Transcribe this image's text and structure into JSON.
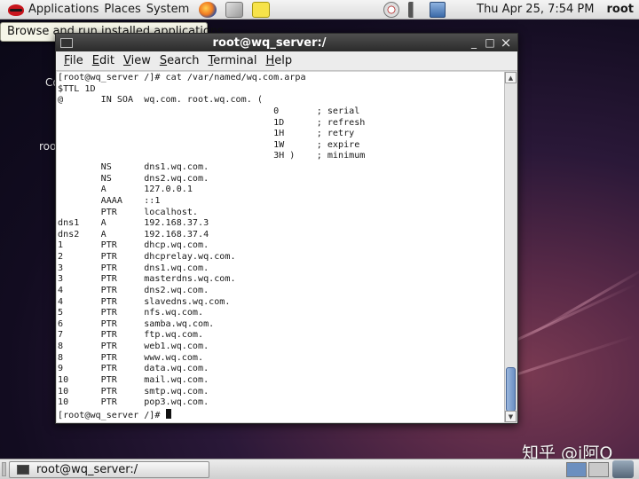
{
  "top_panel": {
    "menus": [
      "Applications",
      "Places",
      "System"
    ],
    "clock": "Thu Apr 25,  7:54 PM",
    "user": "root"
  },
  "tooltip": "Browse and run installed applications",
  "desktop": {
    "fragments": [
      "Co",
      "roo"
    ]
  },
  "window": {
    "title": "root@wq_server:/",
    "controls": {
      "minimize": "_",
      "maximize": "□",
      "close": "×"
    },
    "menus": [
      {
        "first": "F",
        "rest": "ile"
      },
      {
        "first": "E",
        "rest": "dit"
      },
      {
        "first": "V",
        "rest": "iew"
      },
      {
        "first": "S",
        "rest": "earch"
      },
      {
        "first": "T",
        "rest": "erminal"
      },
      {
        "first": "H",
        "rest": "elp"
      }
    ]
  },
  "terminal": {
    "lines": [
      "[root@wq_server /]# cat /var/named/wq.com.arpa",
      "$TTL 1D",
      "@       IN SOA  wq.com. root.wq.com. (",
      "                                        0       ; serial",
      "                                        1D      ; refresh",
      "                                        1H      ; retry",
      "                                        1W      ; expire",
      "                                        3H )    ; minimum",
      "        NS      dns1.wq.com.",
      "        NS      dns2.wq.com.",
      "        A       127.0.0.1",
      "        AAAA    ::1",
      "        PTR     localhost.",
      "dns1    A       192.168.37.3",
      "dns2    A       192.168.37.4",
      "1       PTR     dhcp.wq.com.",
      "2       PTR     dhcprelay.wq.com.",
      "3       PTR     dns1.wq.com.",
      "3       PTR     masterdns.wq.com.",
      "4       PTR     dns2.wq.com.",
      "4       PTR     slavedns.wq.com.",
      "5       PTR     nfs.wq.com.",
      "6       PTR     samba.wq.com.",
      "7       PTR     ftp.wq.com.",
      "8       PTR     web1.wq.com.",
      "8       PTR     www.wq.com.",
      "9       PTR     data.wq.com.",
      "10      PTR     mail.wq.com.",
      "10      PTR     smtp.wq.com.",
      "10      PTR     pop3.wq.com."
    ],
    "prompt": "[root@wq_server /]# "
  },
  "bottom_panel": {
    "task": "root@wq_server:/"
  },
  "watermark": "知乎 @i阿Q"
}
